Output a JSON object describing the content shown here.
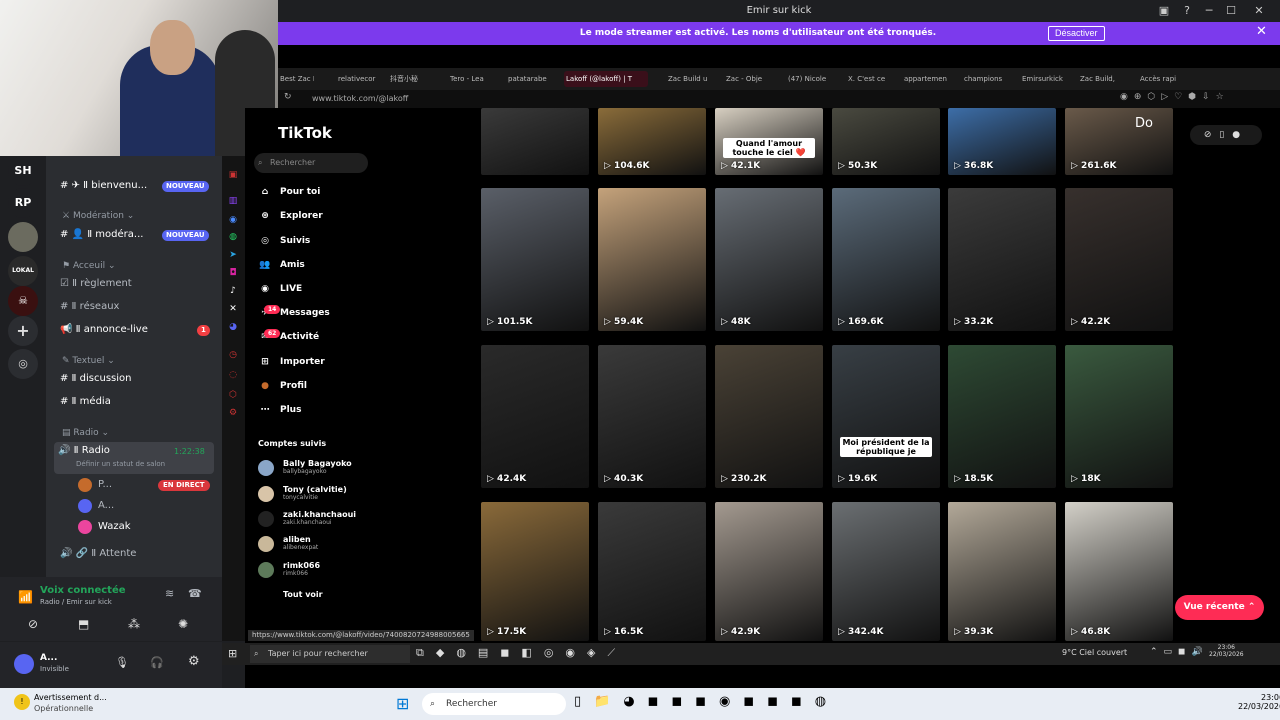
{
  "window": {
    "title": "Emir sur kick"
  },
  "banner": {
    "text": "Le mode streamer est activé. Les noms d'utilisateur ont été tronqués.",
    "button": "Désactiver"
  },
  "guilds": [
    "SH",
    "RP"
  ],
  "discord": {
    "channels": [
      {
        "type": "text",
        "label": "bienvenu...",
        "badge": "NOUVEAU"
      },
      {
        "type": "category",
        "label": "Modération"
      },
      {
        "type": "text",
        "label": "modéra...",
        "badge": "NOUVEAU"
      },
      {
        "type": "category",
        "label": "Acceuil"
      },
      {
        "type": "text",
        "label": "règlement"
      },
      {
        "type": "text",
        "label": "réseaux"
      },
      {
        "type": "text",
        "label": "annonce-live",
        "count": "1"
      },
      {
        "type": "category",
        "label": "Textuel"
      },
      {
        "type": "text",
        "label": "discussion"
      },
      {
        "type": "text",
        "label": "média"
      },
      {
        "type": "category",
        "label": "Radio"
      }
    ],
    "radio": {
      "label": "Radio",
      "timer": "1:22:38",
      "status": "Définir un statut de salon"
    },
    "voice_users": [
      {
        "name": "P...",
        "badge": "EN DIRECT"
      },
      {
        "name": "A..."
      },
      {
        "name": "Wazak"
      }
    ],
    "waiting": "Attente",
    "voice_connected": "Voix connectée",
    "voice_location": "Radio / Emir sur kick",
    "user": {
      "name": "A...",
      "status": "Invisible"
    }
  },
  "browser": {
    "tabs": [
      "Best Zac Pi",
      "relativecor",
      "抖音小秘",
      "Tero - Lea",
      "patatarabe",
      "Lakoff (@lakoff) | T",
      "Zac Build u",
      "Zac - Obje",
      "(47) Nicole",
      "X. C'est ce",
      "appartemen",
      "champions",
      "Emirsurkick",
      "Zac Build,",
      "Accès rapi"
    ],
    "url": "www.tiktok.com/@lakoff",
    "hover_url": "https://www.tiktok.com/@lakoff/video/7400820724988005665"
  },
  "tiktok": {
    "logo": "TikTok",
    "search_placeholder": "Rechercher",
    "nav": [
      {
        "label": "Pour toi",
        "icon": "home-icon"
      },
      {
        "label": "Explorer",
        "icon": "compass-icon"
      },
      {
        "label": "Suivis",
        "icon": "following-icon"
      },
      {
        "label": "Amis",
        "icon": "friends-icon"
      },
      {
        "label": "LIVE",
        "icon": "live-icon"
      },
      {
        "label": "Messages",
        "icon": "message-icon",
        "badge": "14"
      },
      {
        "label": "Activité",
        "icon": "activity-icon",
        "badge": "62"
      },
      {
        "label": "Importer",
        "icon": "upload-icon"
      },
      {
        "label": "Profil",
        "icon": "profile-icon"
      },
      {
        "label": "Plus",
        "icon": "more-icon"
      }
    ],
    "following_title": "Comptes suivis",
    "following": [
      {
        "name": "Bally Bagayoko",
        "user": "ballybagayoko"
      },
      {
        "name": "Tony (calvitie)",
        "user": "tonycalvitie"
      },
      {
        "name": "zaki.khanchaoui",
        "user": "zaki.khanchaoui"
      },
      {
        "name": "aliben",
        "user": "alibenexpat"
      },
      {
        "name": "rimk066",
        "user": "rimk066"
      }
    ],
    "see_all": "Tout voir",
    "videos": [
      [
        "",
        "104.6K",
        "42.1K",
        "50.3K",
        "36.8K",
        "261.6K"
      ],
      [
        "101.5K",
        "59.4K",
        "48K",
        "169.6K",
        "33.2K",
        "42.2K"
      ],
      [
        "42.4K",
        "40.3K",
        "230.2K",
        "19.6K",
        "18.5K",
        "18K"
      ],
      [
        "17.5K",
        "16.5K",
        "42.9K",
        "342.4K",
        "39.3K",
        "46.8K"
      ]
    ],
    "captions": {
      "top": "Quand l'amour touche le ciel ❤️",
      "president": "Moi président de la république je",
      "do": "Do"
    },
    "recent_button": "Vue récente"
  },
  "taskbar_inner": {
    "search": "Taper ici pour rechercher",
    "weather": "9°C  Ciel couvert",
    "time": "23:06",
    "date": "22/03/2026"
  },
  "taskbar": {
    "search": "Rechercher",
    "notif_title": "Avertissement d...",
    "notif_status": "Opérationnelle",
    "time": "23:06",
    "date": "22/03/2026"
  }
}
